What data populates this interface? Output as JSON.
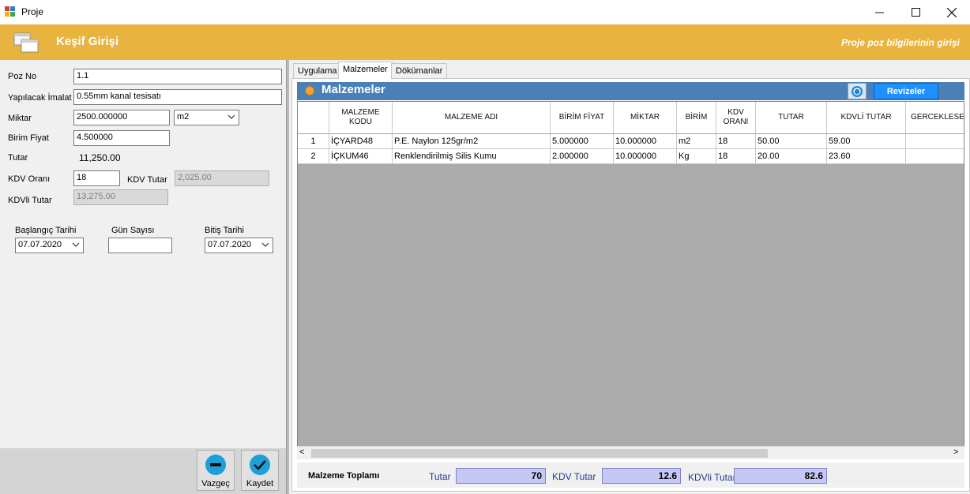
{
  "window": {
    "title": "Proje",
    "controls": {
      "minimize": "—",
      "maximize": "☐",
      "close": "✕"
    }
  },
  "header": {
    "title": "Keşif Girişi",
    "subtitle": "Proje poz bilgilerinin girişi",
    "color": "#e8b33f"
  },
  "form": {
    "poz_no_label": "Poz No",
    "poz_no_value": "1.1",
    "imalat_label": "Yapılacak İmalat",
    "imalat_value": "0.55mm kanal tesisatı",
    "miktar_label": "Miktar",
    "miktar_value": "2500.000000",
    "unit_value": "m2",
    "birim_fiyat_label": "Birim Fiyat",
    "birim_fiyat_value": "4.500000",
    "tutar_label": "Tutar",
    "tutar_value": "11,250.00",
    "kdv_orani_label": "KDV Oranı",
    "kdv_orani_value": "18",
    "kdv_tutar_label": "KDV Tutar",
    "kdv_tutar_value": "2,025.00",
    "kdvli_tutar_label": "KDVli Tutar",
    "kdvli_tutar_value": "13,275.00",
    "baslangic_label": "Başlangıç Tarihi",
    "baslangic_value": "07.07.2020",
    "gun_sayisi_label": "Gün Sayısı",
    "gun_sayisi_value": "",
    "bitis_label": "Bitiş Tarihi",
    "bitis_value": "07.07.2020"
  },
  "actions": {
    "cancel_label": "Vazgeç",
    "save_label": "Kaydet"
  },
  "tabs": [
    {
      "label": "Uygulama",
      "active": false
    },
    {
      "label": "Malzemeler",
      "active": true
    },
    {
      "label": "Dökümanlar",
      "active": false
    }
  ],
  "materials": {
    "title": "Malzemeler",
    "revize_label": "Revizeler",
    "columns": [
      "",
      "MALZEME KODU",
      "MALZEME ADI",
      "BİRİM FİYAT",
      "MİKTAR",
      "BİRİM",
      "KDV ORANI",
      "TUTAR",
      "KDVLİ TUTAR",
      "GERCEKLESEN"
    ],
    "rows": [
      [
        "1",
        "İÇYARD48",
        "P.E. Naylon 125gr/m2",
        "5.000000",
        "10.000000",
        "m2",
        "18",
        "50.00",
        "59.00",
        ""
      ],
      [
        "2",
        "İÇKUM46",
        "Renklendirilmiş Silis Kumu",
        "2.000000",
        "10.000000",
        "Kg",
        "18",
        "20.00",
        "23.60",
        ""
      ]
    ],
    "scroll_left": "<",
    "scroll_right": ">"
  },
  "totals": {
    "label": "Malzeme Toplamı",
    "tutar_label": "Tutar",
    "tutar_value": "70",
    "kdv_label": "KDV  Tutar",
    "kdv_value": "12.6",
    "kdvli_label": "KDVli Tutar",
    "kdvli_value": "82.6"
  }
}
